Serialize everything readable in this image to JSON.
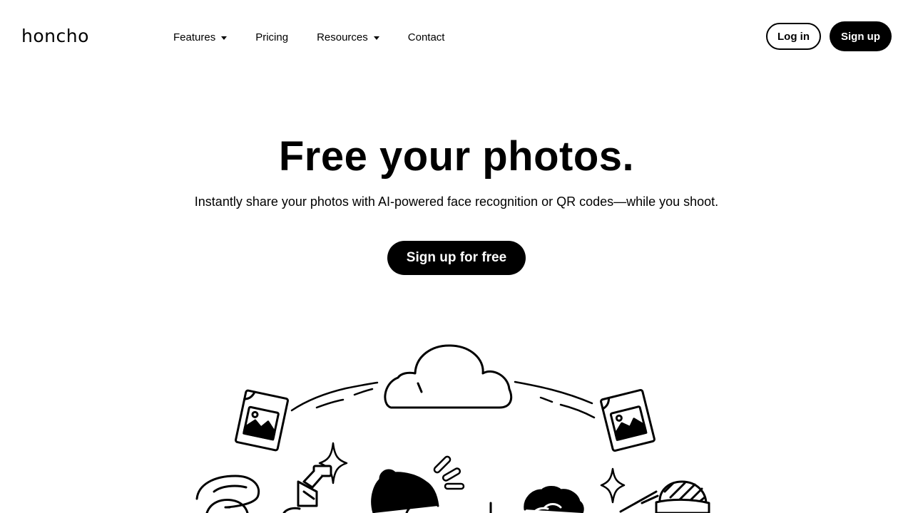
{
  "brand": {
    "logo_text": "honcho"
  },
  "nav": {
    "features": "Features",
    "pricing": "Pricing",
    "resources": "Resources",
    "contact": "Contact"
  },
  "auth": {
    "login_label": "Log in",
    "signup_label": "Sign up"
  },
  "hero": {
    "title": "Free your photos.",
    "subtitle": "Instantly share your photos with AI-powered face recognition or QR codes—while you shoot.",
    "cta_label": "Sign up for free"
  },
  "illustration": {
    "elements": [
      "cloud-icon",
      "photo-file-icon",
      "photo-file-icon",
      "sparkle-icon",
      "sparkle-icon",
      "camera-flash-icon",
      "person-with-cap",
      "person-with-bun",
      "person-with-curly-hair",
      "person-with-beanie"
    ]
  },
  "colors": {
    "accent": "#000000",
    "background": "#ffffff",
    "button_text": "#ffffff"
  }
}
